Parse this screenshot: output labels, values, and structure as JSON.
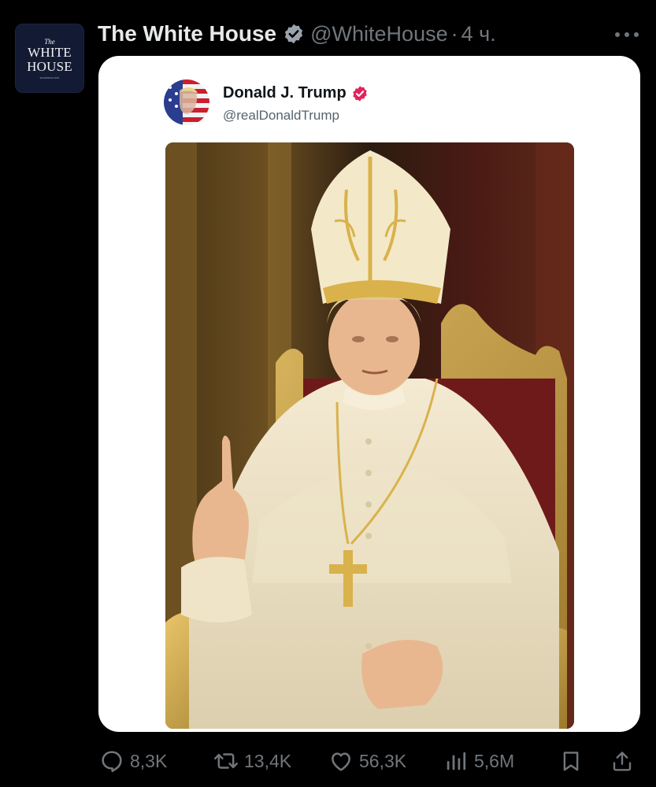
{
  "post": {
    "author": {
      "avatar_text": {
        "top": "The",
        "line1": "WHITE",
        "line2": "HOUSE",
        "small": "WASHINGTON"
      },
      "name": "The White House",
      "handle": "@WhiteHouse",
      "separator": "·",
      "time": "4 ч."
    },
    "more_icon": "more-horizontal-icon",
    "embedded_post": {
      "author_name": "Donald J. Trump",
      "author_handle": "@realDonaldTrump",
      "verified_color": "#e0245e",
      "image_subject": "man in white papal vestments and gold mitre seated on a gold throne, right index finger raised"
    },
    "actions": {
      "replies": "8,3K",
      "reposts": "13,4K",
      "likes": "56,3K",
      "views": "5,6M"
    }
  },
  "colors": {
    "background": "#000000",
    "primary_text": "#e7e9ea",
    "secondary_text": "#71767b",
    "verified_badge": "#1d9bf0",
    "card_background": "#ffffff"
  }
}
